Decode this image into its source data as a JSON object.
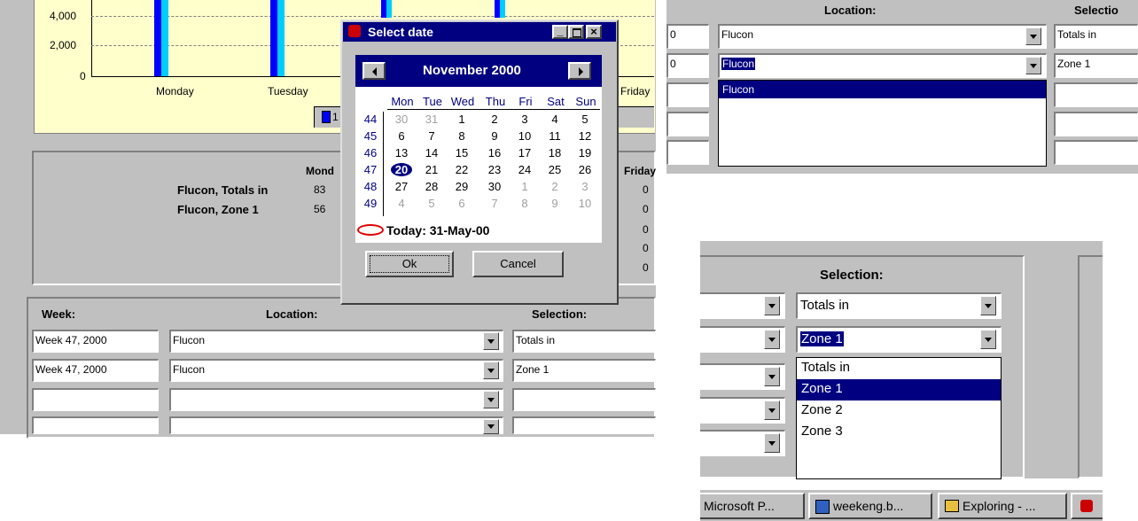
{
  "chart": {
    "y_ticks": [
      "4,000",
      "2,000",
      "0"
    ],
    "x_labels": [
      "Monday",
      "Tuesday",
      "Friday"
    ],
    "legend_partial": "1"
  },
  "summary": {
    "col_header_monday": "Mond",
    "col_header_friday": "Friday",
    "rows": [
      {
        "label": "Flucon, Totals in",
        "monday": "83",
        "friday": "0"
      },
      {
        "label": "Flucon, Zone 1",
        "monday": "56",
        "friday": "0"
      }
    ],
    "extra_friday_values": [
      "0",
      "0",
      "0"
    ]
  },
  "form_main": {
    "headers": {
      "week": "Week:",
      "location": "Location:",
      "selection": "Selection:"
    },
    "rows": [
      {
        "week": "Week 47, 2000",
        "location": "Flucon",
        "selection": "Totals in"
      },
      {
        "week": "Week 47, 2000",
        "location": "Flucon",
        "selection": "Zone 1"
      },
      {
        "week": "",
        "location": "",
        "selection": ""
      },
      {
        "week": "",
        "location": "",
        "selection": ""
      }
    ]
  },
  "dialog": {
    "title": "Select date",
    "month": "November 2000",
    "weekdays": [
      "Mon",
      "Tue",
      "Wed",
      "Thu",
      "Fri",
      "Sat",
      "Sun"
    ],
    "weeks": [
      {
        "num": "44",
        "days": [
          "30",
          "31",
          "1",
          "2",
          "3",
          "4",
          "5"
        ]
      },
      {
        "num": "45",
        "days": [
          "6",
          "7",
          "8",
          "9",
          "10",
          "11",
          "12"
        ]
      },
      {
        "num": "46",
        "days": [
          "13",
          "14",
          "15",
          "16",
          "17",
          "18",
          "19"
        ]
      },
      {
        "num": "47",
        "days": [
          "20",
          "21",
          "22",
          "23",
          "24",
          "25",
          "26"
        ]
      },
      {
        "num": "48",
        "days": [
          "27",
          "28",
          "29",
          "30",
          "1",
          "2",
          "3"
        ]
      },
      {
        "num": "49",
        "days": [
          "4",
          "5",
          "6",
          "7",
          "8",
          "9",
          "10"
        ]
      }
    ],
    "today_label": "Today: 31-May-00",
    "ok": "Ok",
    "cancel": "Cancel"
  },
  "panel_top_right": {
    "location_header": "Location:",
    "selection_header": "Selectio",
    "rows": [
      {
        "week_tail": "0",
        "location": "Flucon",
        "selection": "Totals in"
      },
      {
        "week_tail": "0",
        "location": "Flucon",
        "selection": "Zone 1"
      }
    ],
    "dropdown_item": "Flucon"
  },
  "panel_bottom_right": {
    "selection_header": "Selection:",
    "selection_value_1": "Totals in",
    "selection_value_2": "Zone 1",
    "options": [
      "Totals in",
      "Zone 1",
      "Zone 2",
      "Zone 3"
    ]
  },
  "taskbar": {
    "items": [
      "Microsoft P...",
      "weekeng.b...",
      "Exploring - ..."
    ]
  }
}
